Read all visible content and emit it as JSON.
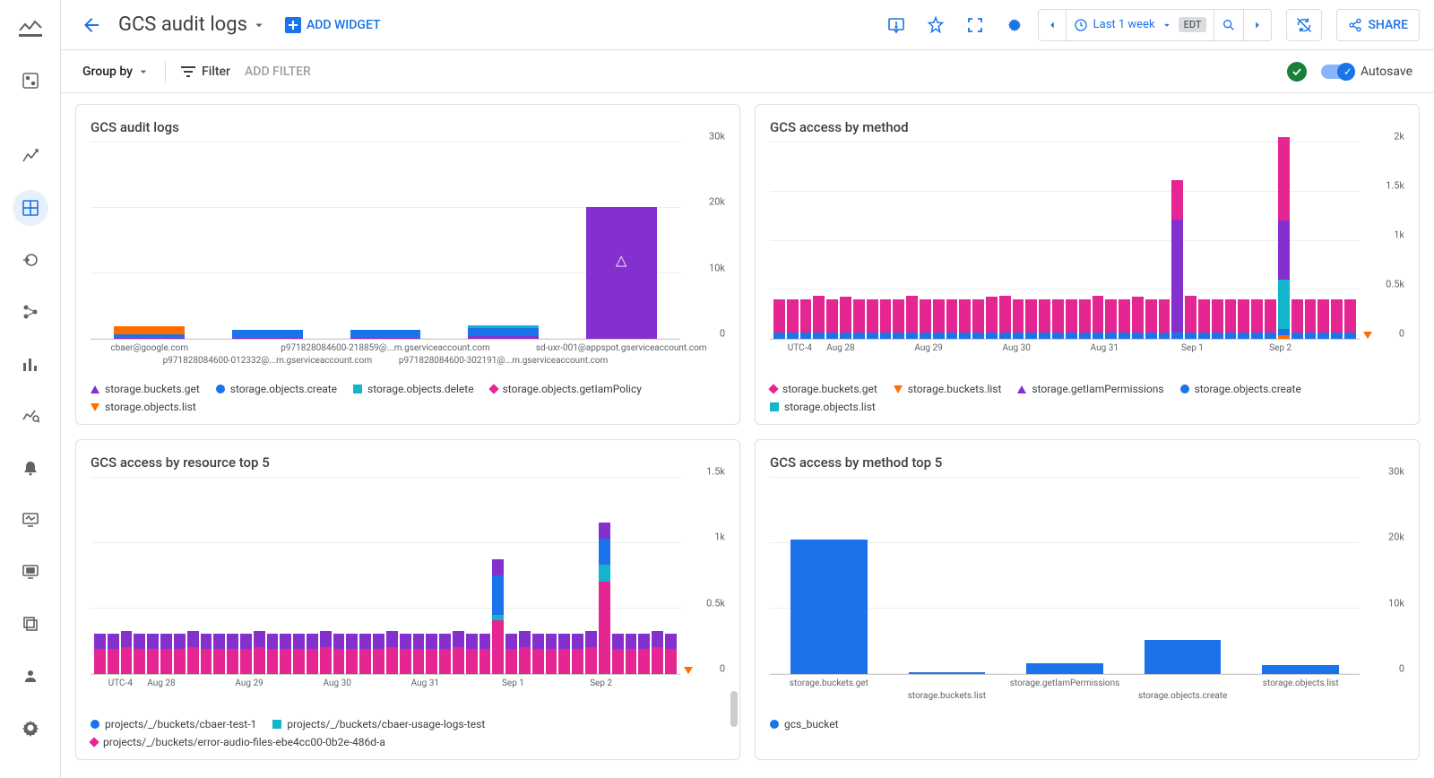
{
  "header": {
    "title": "GCS audit logs",
    "add_widget": "ADD WIDGET",
    "time_label": "Last 1 week",
    "tz_badge": "EDT",
    "share": "SHARE"
  },
  "filterbar": {
    "group_by": "Group by",
    "filter": "Filter",
    "add_filter": "ADD FILTER",
    "autosave": "Autosave"
  },
  "colors": {
    "purple": "#8430ce",
    "blue": "#1a73e8",
    "teal": "#12b5cb",
    "pink": "#e52592",
    "orange": "#ff6d00"
  },
  "chart_data": [
    {
      "id": "c1",
      "title": "GCS audit logs",
      "type": "bar",
      "stacked": true,
      "ylabel": "",
      "ylim": [
        0,
        30000
      ],
      "yticks": [
        0,
        10000,
        20000,
        30000
      ],
      "ytick_labels": [
        "0",
        "10k",
        "20k",
        "30k"
      ],
      "categories": [
        "cbaer@google.com",
        "p971828084600-012332@...m.gserviceaccount.com",
        "p971828084600-218859@...m.gserviceaccount.com",
        "p971828084600-302191@...m.gserviceaccount.com",
        "sd-uxr-001@appspot.gserviceaccount.com"
      ],
      "series": [
        {
          "name": "storage.buckets.get",
          "shape": "triangle-up",
          "color": "#8430ce",
          "values": [
            100,
            200,
            200,
            400,
            20000
          ]
        },
        {
          "name": "storage.objects.create",
          "shape": "circle",
          "color": "#1a73e8",
          "values": [
            600,
            1200,
            1200,
            1300,
            0
          ]
        },
        {
          "name": "storage.objects.delete",
          "shape": "square",
          "color": "#12b5cb",
          "values": [
            0,
            0,
            0,
            300,
            0
          ]
        },
        {
          "name": "storage.objects.getIamPolicy",
          "shape": "diamond",
          "color": "#e52592",
          "values": [
            0,
            0,
            0,
            0,
            0
          ]
        },
        {
          "name": "storage.objects.list",
          "shape": "triangle-down",
          "color": "#ff6d00",
          "values": [
            1200,
            0,
            0,
            0,
            0
          ]
        }
      ],
      "marker_on": 4
    },
    {
      "id": "c2",
      "title": "GCS access by method",
      "type": "bar",
      "stacked": true,
      "ylim": [
        0,
        2000
      ],
      "yticks": [
        0,
        500,
        1000,
        1500,
        2000
      ],
      "ytick_labels": [
        "0",
        "0.5k",
        "1k",
        "1.5k",
        "2k"
      ],
      "x_tz": "UTC-4",
      "categories_dates": [
        "Aug 28",
        "Aug 29",
        "Aug 30",
        "Aug 31",
        "Sep 1",
        "Sep 2"
      ],
      "n_bars": 44,
      "series": [
        {
          "name": "storage.buckets.get",
          "shape": "diamond",
          "color": "#e52592"
        },
        {
          "name": "storage.buckets.list",
          "shape": "triangle-down",
          "color": "#ff6d00"
        },
        {
          "name": "storage.getIamPermissions",
          "shape": "triangle-up",
          "color": "#8430ce"
        },
        {
          "name": "storage.objects.create",
          "shape": "circle",
          "color": "#1a73e8"
        },
        {
          "name": "storage.objects.list",
          "shape": "square",
          "color": "#12b5cb"
        }
      ],
      "base_blue": 60,
      "base_pink": 340,
      "spikes": {
        "30": {
          "teal": 0,
          "purple": 1150,
          "pink": 400
        },
        "38": {
          "teal": 500,
          "purple": 600,
          "pink": 850
        }
      },
      "orange_at": 38
    },
    {
      "id": "c3",
      "title": "GCS access by resource top 5",
      "type": "bar",
      "stacked": true,
      "ylim": [
        0,
        1500
      ],
      "yticks": [
        0,
        500,
        1000,
        1500
      ],
      "ytick_labels": [
        "0",
        "0.5k",
        "1k",
        "1.5k"
      ],
      "x_tz": "UTC-4",
      "categories_dates": [
        "Aug 28",
        "Aug 29",
        "Aug 30",
        "Aug 31",
        "Sep 1",
        "Sep 2"
      ],
      "n_bars": 44,
      "series": [
        {
          "name": "projects/_/buckets/cbaer-test-1",
          "shape": "circle",
          "color": "#1a73e8"
        },
        {
          "name": "projects/_/buckets/cbaer-usage-logs-test",
          "shape": "square",
          "color": "#12b5cb"
        },
        {
          "name": "projects/_/buckets/error-audio-files-ebe4cc00-0b2e-486d-a",
          "shape": "diamond",
          "color": "#e52592"
        }
      ],
      "base_pink": 190,
      "base_purple": 120,
      "spikes": {
        "30": {
          "blue": 300,
          "pink": 410,
          "teal": 40,
          "purple": 120
        },
        "38": {
          "blue": 200,
          "pink": 700,
          "teal": 130,
          "purple": 120
        }
      }
    },
    {
      "id": "c4",
      "title": "GCS access by method top 5",
      "type": "bar",
      "stacked": false,
      "ylim": [
        0,
        30000
      ],
      "yticks": [
        0,
        10000,
        20000,
        30000
      ],
      "ytick_labels": [
        "0",
        "10k",
        "20k",
        "30k"
      ],
      "categories": [
        "storage.buckets.get",
        "storage.buckets.list",
        "storage.getIamPermissions",
        "storage.objects.create",
        "storage.objects.list"
      ],
      "series": [
        {
          "name": "gcs_bucket",
          "shape": "circle",
          "color": "#1a73e8",
          "values": [
            20500,
            300,
            1600,
            5200,
            1400
          ]
        }
      ]
    }
  ]
}
